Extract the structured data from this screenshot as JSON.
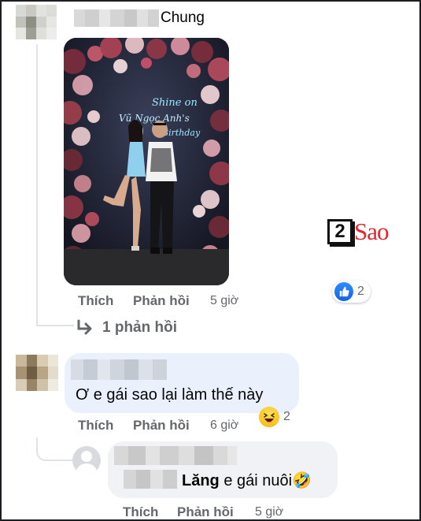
{
  "comment1": {
    "author_visible": "Chung",
    "actions": {
      "like": "Thích",
      "reply": "Phản hồi",
      "time": "5 giờ"
    },
    "reaction": {
      "icon": "like-icon",
      "count": "2"
    },
    "view_replies": "1 phản hồi",
    "photo_sign": {
      "line1": "Shine on",
      "line2": "Vũ Ngọc Anh's",
      "line3": "Birthday"
    }
  },
  "comment2": {
    "text": "Ơ e gái sao lại làm thế này",
    "actions": {
      "like": "Thích",
      "reply": "Phản hồi",
      "time": "6 giờ"
    },
    "reaction": {
      "icon": "haha-icon",
      "count": "2"
    }
  },
  "comment3": {
    "mention": "Lăng",
    "text": "e gái nuôi",
    "emoji": "🤣",
    "actions": {
      "like": "Thích",
      "reply": "Phản hồi",
      "time": "5 giờ"
    }
  },
  "watermark": {
    "digit": "2",
    "word": "Sao"
  },
  "colors": {
    "secondary_text": "#65676b",
    "like_blue": "#1877f2",
    "brand_red": "#e4232d"
  }
}
